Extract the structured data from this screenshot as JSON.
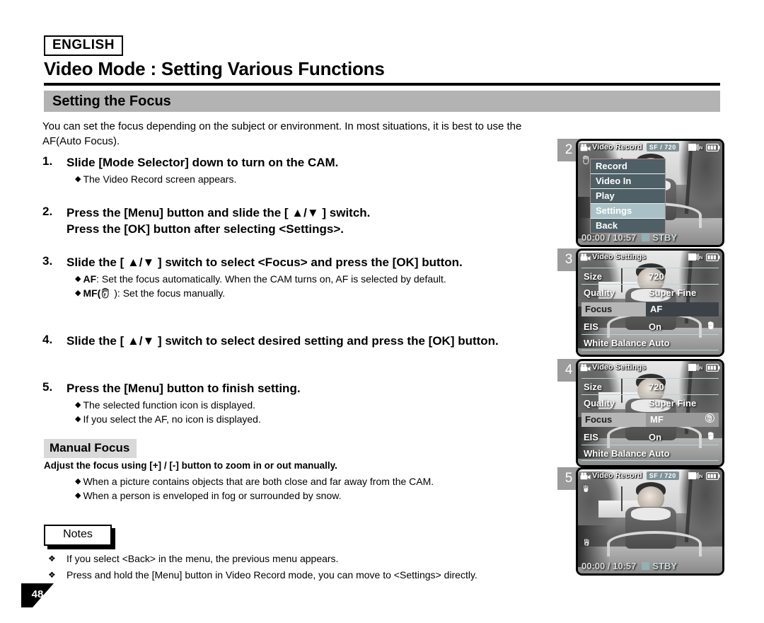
{
  "header": {
    "language": "ENGLISH",
    "title": "Video Mode : Setting Various Functions",
    "section": "Setting the Focus"
  },
  "intro": "You can set the focus depending on the subject or environment. In most situations, it is best to use the AF(Auto Focus).",
  "steps": [
    {
      "num": "1.",
      "head": "Slide [Mode Selector] down to turn on the CAM.",
      "bullets": [
        "The Video Record screen appears."
      ]
    },
    {
      "num": "2.",
      "head": "Press the [Menu] button and slide the [ ▲/▼ ] switch.",
      "head2": "Press the [OK] button after selecting <Settings>.",
      "bullets": []
    },
    {
      "num": "3.",
      "head": "Slide the [ ▲/▼ ] switch to select <Focus> and press the [OK] button.",
      "bullets": [
        "AF: Set the focus automatically. When the CAM turns on, AF is selected by default.",
        "MF(  ): Set the focus manually."
      ]
    },
    {
      "num": "4.",
      "head": "Slide the [ ▲/▼ ] switch to select desired setting and press the [OK] button.",
      "bullets": []
    },
    {
      "num": "5.",
      "head": "Press the [Menu] button to finish setting.",
      "bullets": [
        "The selected function icon is displayed.",
        "If you select the AF, no icon is displayed."
      ]
    }
  ],
  "step3_bullet_af_bold": "AF",
  "step3_bullet_af_rest": ": Set the focus automatically. When the CAM turns on, AF is selected by default.",
  "step3_bullet_mf_bold": "MF(",
  "step3_bullet_mf_rest": " ): Set the focus manually.",
  "manual_focus": {
    "heading": "Manual Focus",
    "subheading": "Adjust the focus using [+] / [-] button to zoom in or out manually.",
    "bullets": [
      "When a picture contains objects that are both close and far away from the CAM.",
      "When a person is enveloped in fog or surrounded by snow."
    ]
  },
  "notes": {
    "label": "Notes",
    "items": [
      "If you select <Back> in the menu, the previous menu appears.",
      "Press and hold the [Menu] button in Video Record mode, you can move to <Settings> directly."
    ]
  },
  "page_number": "48",
  "figures": [
    {
      "step": "2",
      "osd_title": "Video Record",
      "sf_badge": "SF  /  720",
      "in_label": "IN",
      "timer": "00:00 / 10:57",
      "status": "STBY",
      "menu": [
        {
          "label": "Record",
          "selected": false
        },
        {
          "label": "Video In",
          "selected": false
        },
        {
          "label": "Play",
          "selected": false
        },
        {
          "label": "Settings",
          "selected": true
        },
        {
          "label": "Back",
          "selected": false
        }
      ]
    },
    {
      "step": "3",
      "osd_title": "Video Settings",
      "rows": [
        {
          "label": "Size",
          "value": "720",
          "active": false
        },
        {
          "label": "Quality",
          "value": "Super Fine",
          "active": false
        },
        {
          "label": "Focus",
          "value": "AF",
          "active": true
        },
        {
          "label": "EIS",
          "value": "On",
          "active": false,
          "hand": true
        },
        {
          "label": "White Balance",
          "value": "Auto",
          "active": false
        }
      ]
    },
    {
      "step": "4",
      "osd_title": "Video Settings",
      "rows": [
        {
          "label": "Size",
          "value": "720",
          "active": false
        },
        {
          "label": "Quality",
          "value": "Super Fine",
          "active": false
        },
        {
          "label": "Focus",
          "value": "MF",
          "active": true,
          "mf": true
        },
        {
          "label": "EIS",
          "value": "On",
          "active": false,
          "hand": true
        },
        {
          "label": "White Balance",
          "value": "Auto",
          "active": false
        }
      ]
    },
    {
      "step": "5",
      "osd_title": "Video Record",
      "sf_badge": "SF  /  720",
      "in_label": "IN",
      "timer": "00:00 / 10:57",
      "status": "STBY",
      "mf_icon": true
    }
  ],
  "colors": {
    "section_bar": "#b3b3b3",
    "menu_item": "#4e5f66",
    "menu_selected": "#a9c1c6",
    "chip": "#9b9b9b",
    "badge": "#7f9399"
  }
}
